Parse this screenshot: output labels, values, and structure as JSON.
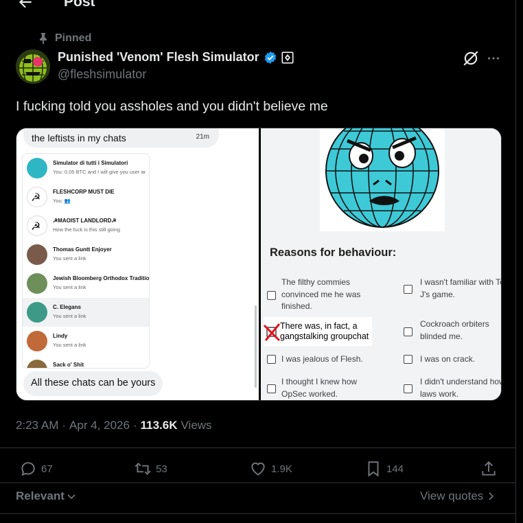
{
  "header": {
    "title": "Post"
  },
  "pinned": {
    "label": "Pinned"
  },
  "author": {
    "name": "Punished 'Venom' Flesh Simulator",
    "handle": "@fleshsimulator"
  },
  "tweet": {
    "text": "I fucking told you assholes and you didn't believe me"
  },
  "media": {
    "left": {
      "top_bubble": "the leftists in my chats",
      "top_bubble_time": "21m",
      "chats": [
        {
          "name": "Simulator di tutti i Simulatori",
          "sub": "You: 0.05 BTC and I will give you user ar"
        },
        {
          "name": "FLESHCORP MUST DIE",
          "sub": "You: 👥"
        },
        {
          "name": "☭MAOIST LANDLORD☭",
          "sub": "How the fuck is this still going"
        },
        {
          "name": "Thomas Guntt Enjoyer",
          "sub": "You sent a link"
        },
        {
          "name": "Jewish Bloomberg Orthodox Traditio..",
          "sub": "You sent a link"
        },
        {
          "name": "C. Elegans",
          "sub": "You sent a link"
        },
        {
          "name": "Lindy",
          "sub": "You sent a link"
        },
        {
          "name": "Sack o' Shit",
          "sub": ""
        }
      ],
      "bottom_bubble": "All these chats can be yours"
    },
    "right": {
      "title": "Reasons for behaviour:",
      "options": [
        "The filthy commies convinced me he was finished.",
        "I wasn't familiar with Top J's game.",
        "There was, in fact, a gangstalking groupchat",
        "Cockroach orbiters blinded me.",
        "I was jealous of Flesh.",
        "I was on crack.",
        "I thought I knew how OpSec worked.",
        "I didn't understand how laws work."
      ]
    }
  },
  "meta": {
    "time": "2:23 AM",
    "date": "Apr 4, 2026",
    "views_count": "113.6K",
    "views_label": "Views"
  },
  "actions": {
    "replies": "67",
    "reposts": "53",
    "likes": "1.9K",
    "bookmarks": "144"
  },
  "footer": {
    "sort": "Relevant",
    "view_quotes": "View quotes"
  },
  "colors": {
    "background": "#000000",
    "text": "#e7e9ea",
    "muted": "#71767b",
    "verified": "#1d9bf0",
    "globe": "#3ec9d6"
  }
}
